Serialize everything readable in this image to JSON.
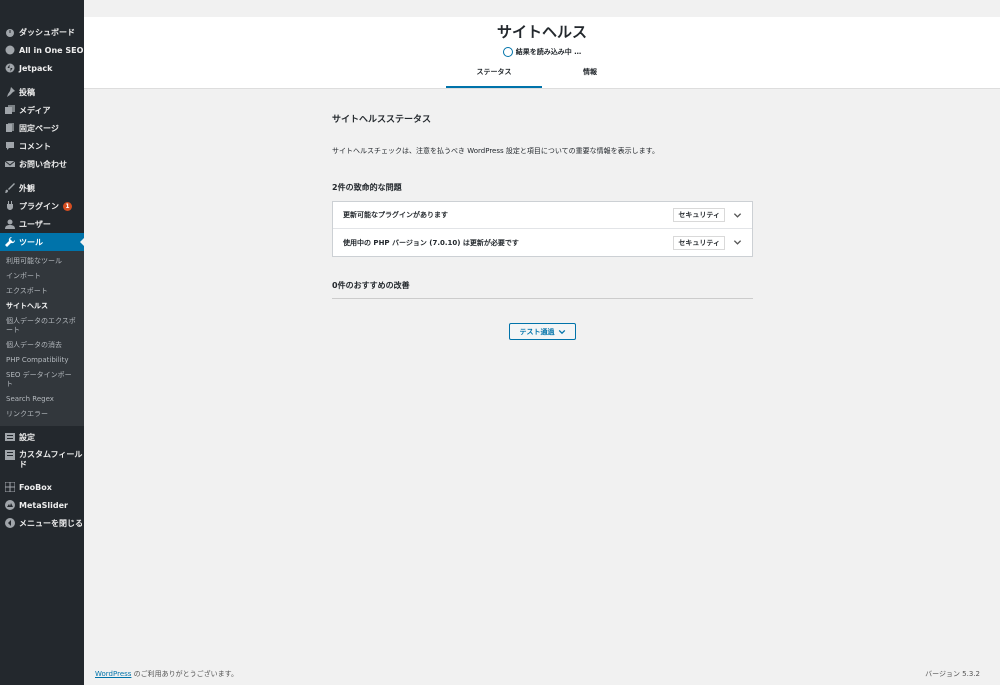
{
  "sidebar": {
    "groups": [
      [
        {
          "id": "dashboard",
          "icon": "dashboard-icon",
          "label": "ダッシュボード"
        },
        {
          "id": "aioseo",
          "icon": "aioseo-icon",
          "label": "All in One SEO"
        },
        {
          "id": "jetpack",
          "icon": "jetpack-icon",
          "label": "Jetpack"
        }
      ],
      [
        {
          "id": "posts",
          "icon": "pin-icon",
          "label": "投稿"
        },
        {
          "id": "media",
          "icon": "media-icon",
          "label": "メディア"
        },
        {
          "id": "pages",
          "icon": "pages-icon",
          "label": "固定ページ"
        },
        {
          "id": "comments",
          "icon": "comment-icon",
          "label": "コメント"
        },
        {
          "id": "contact",
          "icon": "mail-icon",
          "label": "お問い合わせ"
        }
      ],
      [
        {
          "id": "appearance",
          "icon": "brush-icon",
          "label": "外観"
        },
        {
          "id": "plugins",
          "icon": "plug-icon",
          "label": "プラグイン",
          "badge": "1"
        },
        {
          "id": "users",
          "icon": "user-icon",
          "label": "ユーザー"
        },
        {
          "id": "tools",
          "icon": "wrench-icon",
          "label": "ツール",
          "current": true
        }
      ]
    ],
    "tools_submenu": [
      "利用可能なツール",
      "インポート",
      "エクスポート",
      "サイトヘルス",
      "個人データのエクスポート",
      "個人データの消去",
      "PHP Compatibility",
      "SEO データインポート",
      "Search Regex",
      "リンクエラー"
    ],
    "tools_submenu_active": "サイトヘルス",
    "after": [
      {
        "id": "settings",
        "icon": "settings-icon",
        "label": "設定"
      },
      {
        "id": "custom-fields",
        "icon": "fields-icon",
        "label": "カスタムフィールド"
      }
    ],
    "bottom": [
      {
        "id": "foobox",
        "icon": "grid-icon",
        "label": "FooBox"
      },
      {
        "id": "metaslider",
        "icon": "metaslider-icon",
        "label": "MetaSlider"
      },
      {
        "id": "collapse",
        "icon": "collapse-icon",
        "label": "メニューを閉じる"
      }
    ]
  },
  "header": {
    "title": "サイトヘルス",
    "progress_text": "結果を読み込み中 …",
    "tabs": [
      {
        "label": "ステータス",
        "active": true
      },
      {
        "label": "情報",
        "active": false
      }
    ]
  },
  "main": {
    "status_heading": "サイトヘルスステータス",
    "description": "サイトヘルスチェックは、注意を払うべき WordPress 設定と項目についての重要な情報を表示します。",
    "critical_heading": "2件の致命的な問題",
    "issues": [
      {
        "label": "更新可能なプラグインがあります",
        "tag": "セキュリティ"
      },
      {
        "label": "使用中の PHP バージョン (7.0.10) は更新が必要です",
        "tag": "セキュリティ"
      }
    ],
    "recommended_heading": "0件のおすすめの改善",
    "passed_button": "テスト通過"
  },
  "footer": {
    "wp_link": "WordPress",
    "thanks": " のご利用ありがとうございます。",
    "version": "バージョン 5.3.2"
  },
  "colors": {
    "accent": "#0073aa",
    "sidebar_bg": "#23282d",
    "submenu_bg": "#32373c",
    "badge": "#d54e21"
  }
}
